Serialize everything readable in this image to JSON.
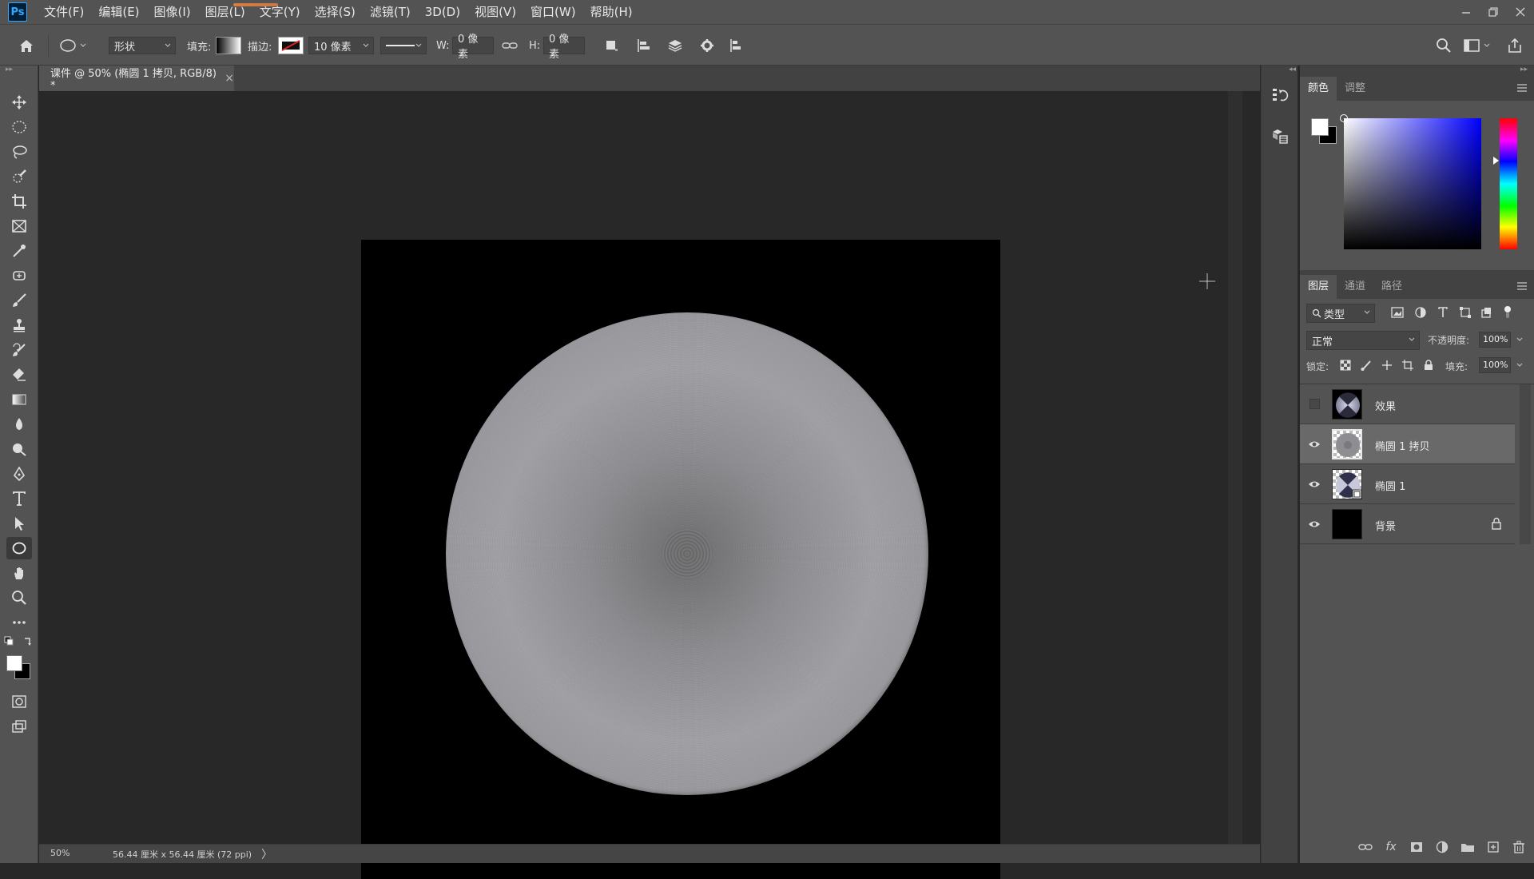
{
  "app": {
    "logo": "Ps"
  },
  "menu": [
    "文件(F)",
    "编辑(E)",
    "图像(I)",
    "图层(L)",
    "文字(Y)",
    "选择(S)",
    "滤镜(T)",
    "3D(D)",
    "视图(V)",
    "窗口(W)",
    "帮助(H)"
  ],
  "options": {
    "mode_value": "形状",
    "fill_label": "填充:",
    "stroke_label": "描边:",
    "stroke_width": "10 像素",
    "w_label": "W:",
    "w_value": "0 像素",
    "h_label": "H:",
    "h_value": "0 像素"
  },
  "document": {
    "tab_title": "课件 @ 50% (椭圆 1 拷贝, RGB/8) *",
    "close_glyph": "×",
    "canvas_color": "#000000"
  },
  "status": {
    "zoom": "50%",
    "doc_size": "56.44 厘米 x 56.44 厘米 (72 ppi)",
    "arrow": "〉"
  },
  "color_panel": {
    "tabs": [
      "颜色",
      "调整"
    ],
    "foreground": "#ffffff",
    "background": "#000000",
    "hue": "#0000ff"
  },
  "layers_panel": {
    "tabs": [
      "图层",
      "通道",
      "路径"
    ],
    "kind_filter": "类型",
    "blend_mode": "正常",
    "opacity_label": "不透明度:",
    "opacity_value": "100%",
    "lock_label": "锁定:",
    "fill_label": "填充:",
    "fill_value": "100%",
    "layers": [
      {
        "name": "效果",
        "visible": false,
        "selected": false,
        "locked": false
      },
      {
        "name": "椭圆 1 拷贝",
        "visible": true,
        "selected": true,
        "locked": false
      },
      {
        "name": "椭圆 1",
        "visible": true,
        "selected": false,
        "locked": false
      },
      {
        "name": "背景",
        "visible": true,
        "selected": false,
        "locked": true
      }
    ],
    "footer_fx": "fx"
  },
  "colors": {
    "accent": "#31a8ff",
    "panel": "#535353",
    "workspace": "#282828"
  }
}
